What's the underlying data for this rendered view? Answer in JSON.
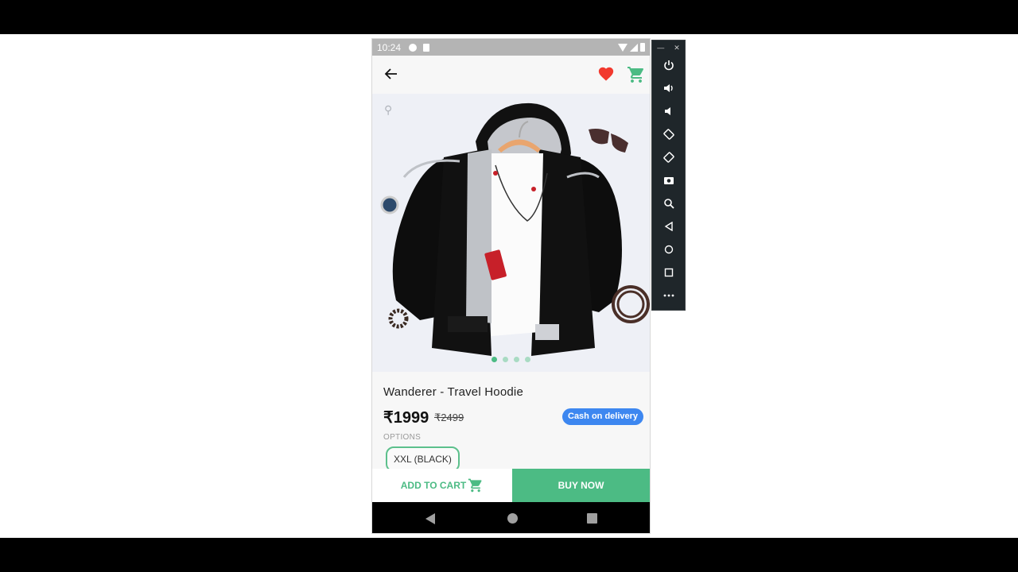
{
  "statusbar": {
    "time": "10:24"
  },
  "appbar": {
    "back_icon": "arrow-left-icon",
    "wishlist_icon": "heart-icon",
    "cart_icon": "cart-icon"
  },
  "carousel": {
    "image_description": "Black hoodie with grey lining over white t-shirt on wooden hanger, surrounded by sunglasses, watch, bracelet, belt and earphones",
    "page_count": 4,
    "active_page": 1
  },
  "product": {
    "title": "Wanderer - Travel Hoodie",
    "price": "₹1999",
    "mrp": "₹2499",
    "cod_badge": "Cash on delivery",
    "options_label": "OPTIONS",
    "selected_option": "XXL (BLACK)"
  },
  "actions": {
    "add_to_cart": "ADD TO CART",
    "buy_now": "BUY NOW"
  },
  "colors": {
    "accent_green": "#4cbb84",
    "badge_blue": "#3d87f0",
    "heart_red": "#f2392e"
  },
  "emulator_toolbar": {
    "items": [
      "minimize",
      "close",
      "power",
      "volume-up",
      "volume-down",
      "rotate-left",
      "rotate-right",
      "screenshot",
      "zoom",
      "back",
      "home",
      "overview",
      "more"
    ]
  }
}
